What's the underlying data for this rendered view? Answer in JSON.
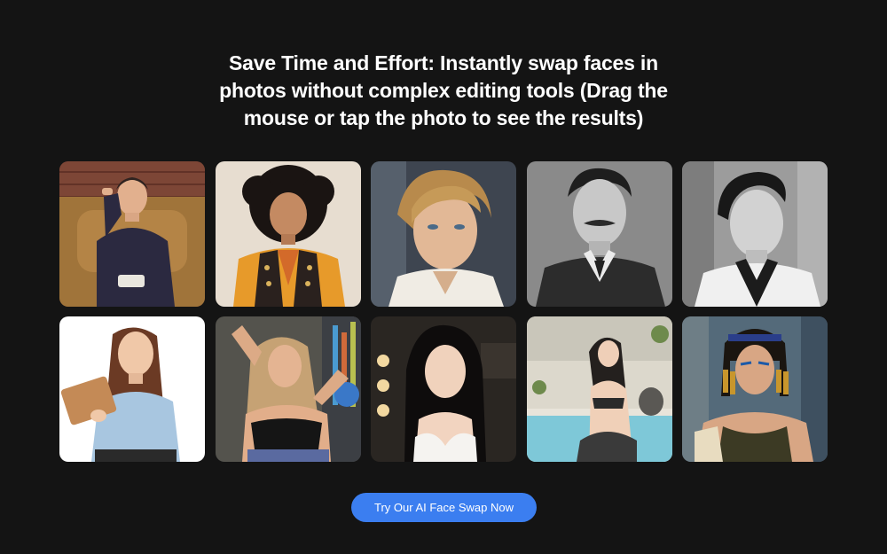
{
  "headline": {
    "line1": "Save Time and Effort: Instantly swap faces in",
    "line2": "photos without complex editing tools (Drag the",
    "line3": "mouse or tap the photo to see the results)"
  },
  "cta": {
    "label": "Try Our AI Face Swap Now",
    "color": "#3b7ef0"
  },
  "theme": {
    "background": "#141414",
    "text": "#ffffff"
  }
}
